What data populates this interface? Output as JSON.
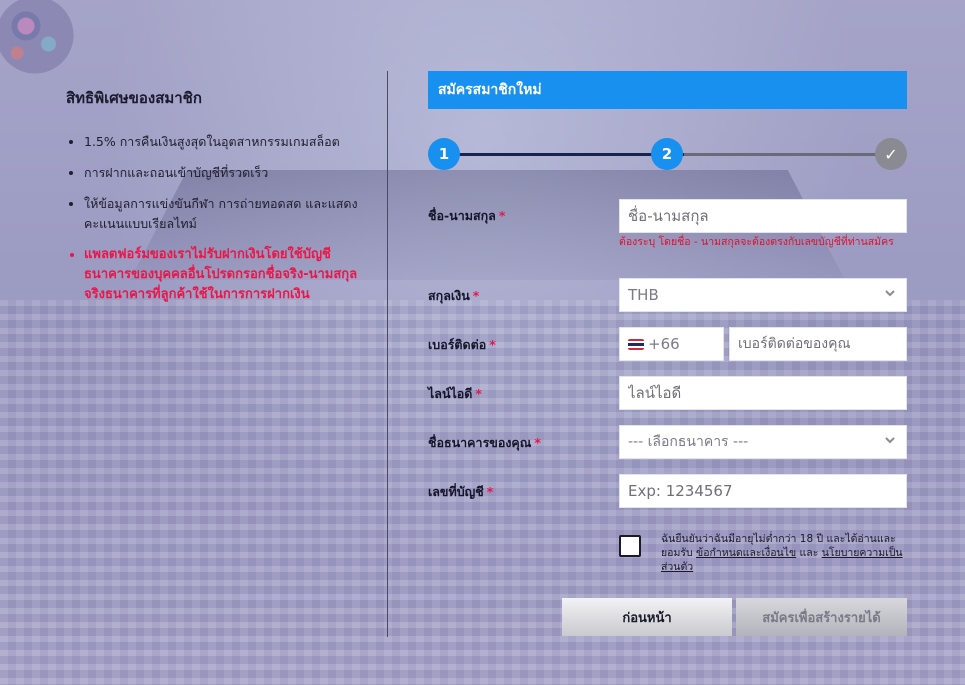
{
  "benefits": {
    "title": "สิทธิพิเศษของสมาชิก",
    "items": [
      "1.5% การคืนเงินสูงสุดในอุตสาหกรรมเกมสล็อต",
      "การฝากและถอนเข้าบัญชีที่รวดเร็ว",
      "ให้ข้อมูลการแข่งขันกีฬา การถ่ายทอดสด และแสดงคะแนนแบบเรียลไทม์"
    ],
    "warning": "แพลตฟอร์มของเราไม่รับฝากเงินโดยใช้บัญชีธนาคารของบุคคลอื่นโปรดกรอกชื่อจริง-นามสกุลจริงธนาคารที่ลูกค้าใช้ในการการฝากเงิน"
  },
  "form": {
    "title": "สมัครสมาชิกใหม่",
    "steps": [
      "1",
      "2",
      "✓"
    ],
    "required_mark": "*",
    "fullname": {
      "label": "ชื่อ-นามสกุล",
      "placeholder": "ชื่อ-นามสกุล",
      "error": "ต้องระบุ โดยชื่อ - นามสกุลจะต้องตรงกับเลขบัญชีที่ท่านสมัคร"
    },
    "currency": {
      "label": "สกุลเงิน",
      "value": "THB"
    },
    "phone": {
      "label": "เบอร์ติดต่อ",
      "country_code": "+66",
      "placeholder": "เบอร์ติดต่อของคุณ"
    },
    "line_id": {
      "label": "ไลน์ไอดี",
      "placeholder": "ไลน์ไอดี"
    },
    "bank": {
      "label": "ชื่อธนาคารของคุณ",
      "value": "--- เลือกธนาคาร ---"
    },
    "account": {
      "label": "เลขที่บัญชี",
      "placeholder": "Exp: 1234567"
    },
    "terms": {
      "text_before": "ฉันยืนยันว่าฉันมีอายุไม่ต่ำกว่า 18 ปี และได้อ่านและยอมรับ",
      "link_terms": "ข้อกำหนดและเงื่อนไข",
      "text_and": "และ",
      "link_privacy": "นโยบายความเป็นส่วนตัว"
    },
    "back_button": "ก่อนหน้า",
    "submit_button": "สมัครเพื่อสร้างรายได้"
  },
  "colors": {
    "accent": "#1790f0",
    "warning": "#e8174a"
  }
}
